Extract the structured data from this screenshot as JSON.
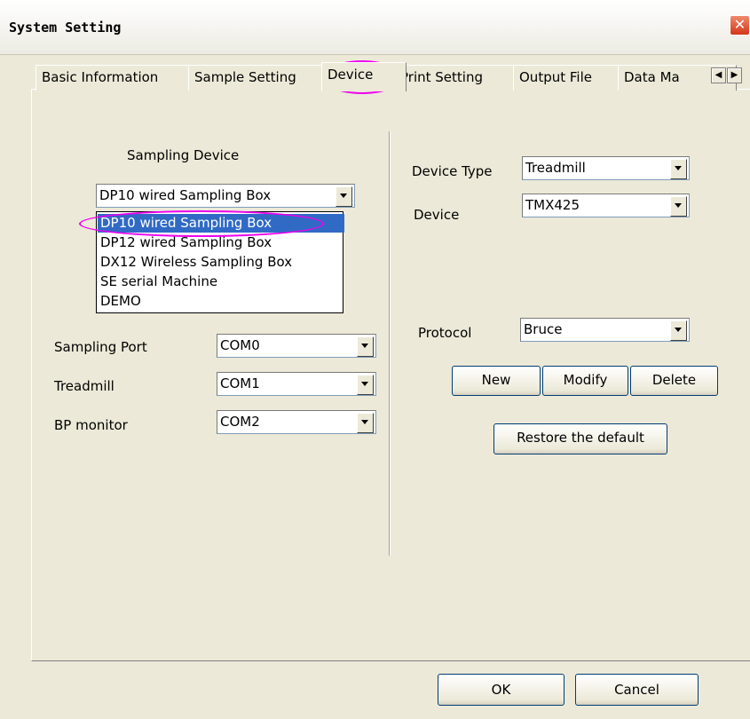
{
  "window": {
    "title": "System Setting",
    "close_glyph": "✕"
  },
  "tabs": [
    {
      "label": "Basic Information"
    },
    {
      "label": "Sample Setting"
    },
    {
      "label": "Device"
    },
    {
      "label": "Print Setting"
    },
    {
      "label": "Output File"
    },
    {
      "label": "Data Ma"
    }
  ],
  "tab_scroll": {
    "left": "◀",
    "right": "▶"
  },
  "sampling_device": {
    "heading": "Sampling Device",
    "selected": "DP10 wired Sampling Box",
    "options": [
      "DP10 wired Sampling Box",
      "DP12 wired Sampling Box",
      "DX12 Wireless Sampling Box",
      "SE serial Machine",
      "DEMO"
    ]
  },
  "ports": {
    "sampling_port": {
      "label": "Sampling Port",
      "value": "COM0"
    },
    "treadmill": {
      "label": "Treadmill",
      "value": "COM1"
    },
    "bp_monitor": {
      "label": "BP monitor",
      "value": "COM2"
    }
  },
  "device": {
    "type_label": "Device Type",
    "type_value": "Treadmill",
    "device_label": "Device",
    "device_value": "TMX425",
    "protocol_label": "Protocol",
    "protocol_value": "Bruce"
  },
  "buttons": {
    "new": "New",
    "modify": "Modify",
    "delete": "Delete",
    "restore": "Restore the default",
    "ok": "OK",
    "cancel": "Cancel"
  },
  "colors": {
    "highlight": "#316ac5",
    "annotation": "#ee00ee"
  }
}
